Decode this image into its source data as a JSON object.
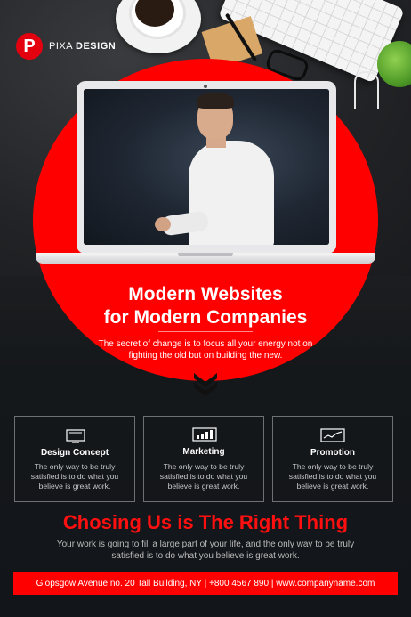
{
  "brand": {
    "logo_letter": "P",
    "name_part1": "PIXA",
    "name_part2": "DESIGN"
  },
  "hero": {
    "headline_line1": "Modern Websites",
    "headline_line2": "for Modern Companies",
    "subtext": "The secret of change is to focus all your energy not on fighting the old but on building the new."
  },
  "services": [
    {
      "icon": "monitor-icon",
      "title": "Design Concept",
      "text": "The only way to be truly satisfied is to do what you believe is great work."
    },
    {
      "icon": "bar-chart-icon",
      "title": "Marketing",
      "text": "The only way to be truly satisfied is to do what you believe is great work."
    },
    {
      "icon": "line-chart-icon",
      "title": "Promotion",
      "text": "The only way to be truly satisfied is to do what you believe is great work."
    }
  ],
  "cta": {
    "title": "Chosing Us is The Right Thing",
    "text": "Your work is going to fill a large part of your life, and the only way to be truly satisfied is to do what you believe is great work."
  },
  "footer": {
    "contact": "Glopsgow Avenue no. 20 Tall Building, NY  |  +800 4567 890 | www.companyname.com"
  },
  "colors": {
    "accent": "#ff0000",
    "background": "#15181b"
  }
}
